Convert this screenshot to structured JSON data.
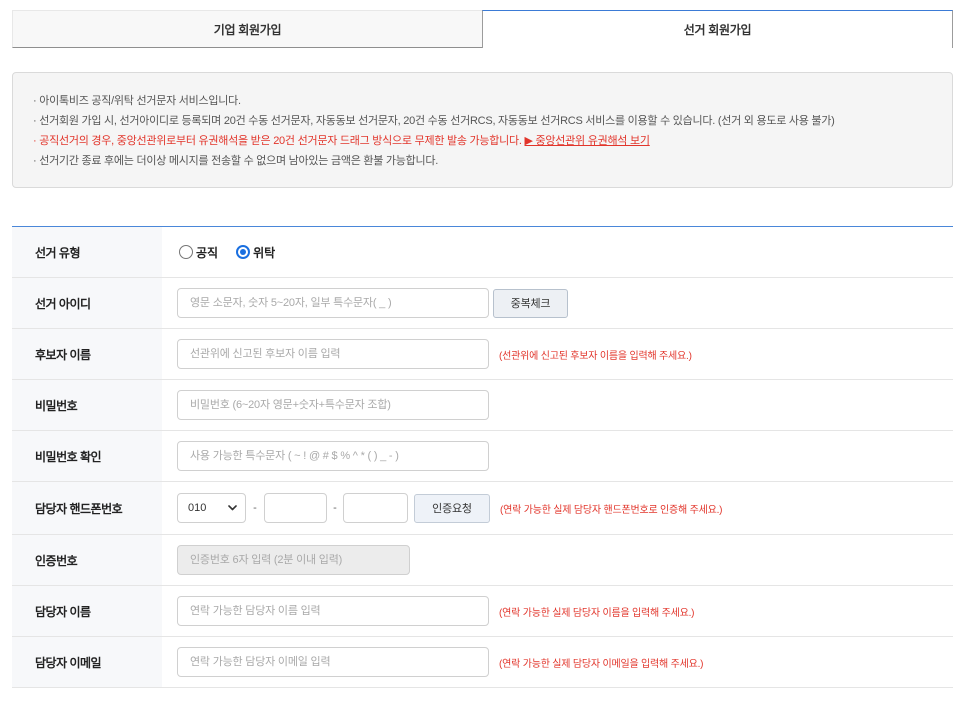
{
  "tabs": {
    "corporate": "기업 회원가입",
    "election": "선거 회원가입"
  },
  "notice": {
    "line1": "· 아이톡비즈 공직/위탁 선거문자 서비스입니다.",
    "line2": "· 선거회원 가입 시, 선거아이디로 등록되며 20건 수동 선거문자, 자동동보 선거문자, 20건 수동 선거RCS, 자동동보 선거RCS 서비스를 이용할 수 있습니다. (선거 외 용도로 사용 불가)",
    "line3": "· 공직선거의 경우, 중앙선관위로부터 유권해석을 받은 20건 선거문자 드래그 방식으로 무제한 발송 가능합니다.",
    "line3_link": "▶ 중앙선관위 유권해석 보기",
    "line4": "· 선거기간 종료 후에는 더이상 메시지를 전송할 수 없으며 남아있는 금액은 환불 가능합니다."
  },
  "form": {
    "election_type": {
      "label": "선거 유형",
      "options": [
        {
          "label": "공직",
          "checked": false
        },
        {
          "label": "위탁",
          "checked": true
        }
      ]
    },
    "user_id": {
      "label": "선거 아이디",
      "placeholder": "영문 소문자, 숫자 5~20자, 일부 특수문자( _ )",
      "button": "중복체크"
    },
    "candidate_name": {
      "label": "후보자 이름",
      "placeholder": "선관위에 신고된 후보자 이름 입력",
      "note": "(선관위에 신고된 후보자 이름을 입력해 주세요.)"
    },
    "password": {
      "label": "비밀번호",
      "placeholder": "비밀번호 (6~20자 영문+숫자+특수문자 조합)"
    },
    "password_confirm": {
      "label": "비밀번호 확인",
      "placeholder": "사용 가능한 특수문자 ( ~ ! @ # $ % ^ * ( ) _ - )"
    },
    "phone": {
      "label": "담당자 핸드폰번호",
      "prefix": "010",
      "separator": "-",
      "button": "인증요청",
      "note": "(연락 가능한 실제 담당자 핸드폰번호로 인증해 주세요.)"
    },
    "verify_code": {
      "label": "인증번호",
      "placeholder": "인증번호 6자 입력 (2분 이내 입력)"
    },
    "manager_name": {
      "label": "담당자 이름",
      "placeholder": "연락 가능한 담당자 이름 입력",
      "note": "(연락 가능한 실제 담당자 이름을 입력해 주세요.)"
    },
    "manager_email": {
      "label": "담당자 이메일",
      "placeholder": "연락 가능한 담당자 이메일 입력",
      "note": "(연락 가능한 실제 담당자 이메일을 입력해 주세요.)"
    }
  },
  "colors": {
    "accent": "#1a6fe0",
    "active_tab_border": "#3b7bd6",
    "warning_red": "#e2352b",
    "label_bg": "#f7f8fa",
    "notice_bg": "#f5f5f5"
  },
  "icons": {
    "phone_prefix_dropdown": "chevron-down-icon"
  }
}
